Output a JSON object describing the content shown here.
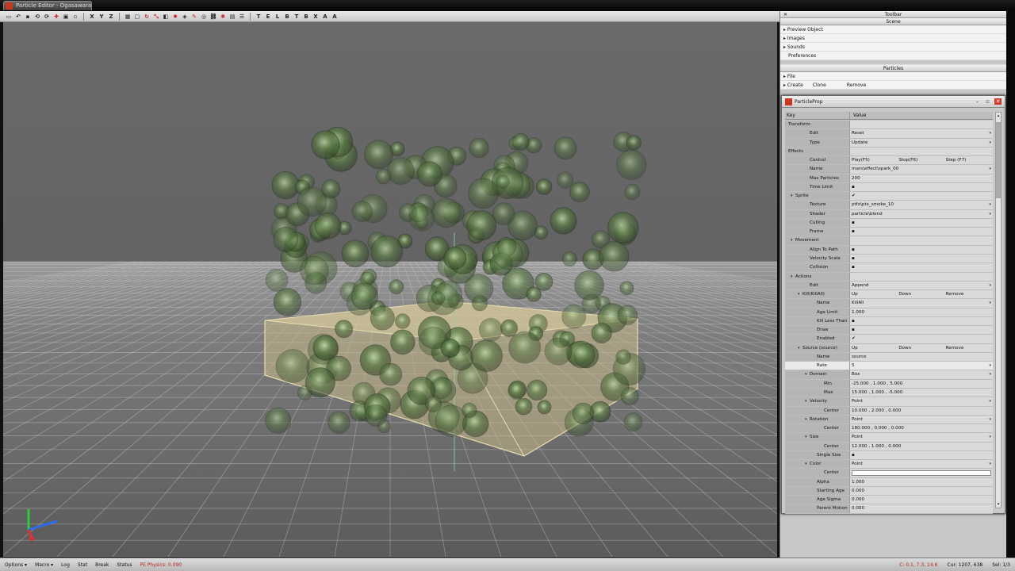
{
  "window": {
    "title": "Particle Editor - Ogasawara"
  },
  "toolbar": {
    "axis_labels": [
      "X",
      "Y",
      "Z"
    ],
    "letters": [
      "T",
      "E",
      "L",
      "B",
      "T",
      "B",
      "X",
      "A",
      "A"
    ]
  },
  "dock": {
    "toolbar_title": "Toolbar",
    "scene_title": "Scene",
    "scene_items": [
      "Preview Object",
      "Images",
      "Sounds",
      "Preferences"
    ],
    "particles_title": "Particles",
    "file_label": "File",
    "actions": [
      "Create",
      "Clone",
      "Remove"
    ]
  },
  "propwin": {
    "title": "ParticleProp",
    "col_key": "Key",
    "col_value": "Value",
    "rows": [
      {
        "k": "Transform",
        "ind": 0,
        "tog": "▾"
      },
      {
        "k": "Edit",
        "ind": 3,
        "v": [
          "Reset"
        ],
        "dd": true
      },
      {
        "k": "Type",
        "ind": 3,
        "v": [
          "Update"
        ],
        "dd": true
      },
      {
        "k": "Effects",
        "ind": 0,
        "tog": "▾"
      },
      {
        "k": "Control",
        "ind": 3,
        "v": [
          "Play(F5)",
          "Stop(F6)",
          "Step (F7)"
        ]
      },
      {
        "k": "Name",
        "ind": 3,
        "v": [
          "mars\\effect\\spark_00"
        ],
        "dd": true
      },
      {
        "k": "Max Particles",
        "ind": 3,
        "v": [
          "200"
        ]
      },
      {
        "k": "Time Limit",
        "ind": 3,
        "v": [
          "▪"
        ]
      },
      {
        "k": "Sprite",
        "ind": 1,
        "tog": "▾",
        "v": [
          "✔"
        ]
      },
      {
        "k": "Texture",
        "ind": 3,
        "v": [
          "ptfx\\ptx_smoke_10"
        ],
        "dd": true
      },
      {
        "k": "Shader",
        "ind": 3,
        "v": [
          "particle\\blend"
        ],
        "dd": true
      },
      {
        "k": "Culling",
        "ind": 3,
        "v": [
          "▪"
        ]
      },
      {
        "k": "Frame",
        "ind": 3,
        "v": [
          "▪"
        ]
      },
      {
        "k": "Movement",
        "ind": 1,
        "tog": "▾"
      },
      {
        "k": "Align To Path",
        "ind": 3,
        "v": [
          "▪"
        ]
      },
      {
        "k": "Velocity Scale",
        "ind": 3,
        "v": [
          "▪"
        ]
      },
      {
        "k": "Collision",
        "ind": 3,
        "v": [
          "▪"
        ]
      },
      {
        "k": "Actions",
        "ind": 1,
        "tog": "▾"
      },
      {
        "k": "Edit",
        "ind": 3,
        "v": [
          "Append"
        ],
        "dd": true
      },
      {
        "k": "Kill(KillAll)",
        "ind": 2,
        "tog": "▾",
        "v": [
          "Up",
          "Down",
          "Remove"
        ]
      },
      {
        "k": "Name",
        "ind": 4,
        "v": [
          "KillAll"
        ],
        "dd": true
      },
      {
        "k": "Age Limit",
        "ind": 4,
        "v": [
          "1.000"
        ]
      },
      {
        "k": "Kill Less Than",
        "ind": 4,
        "v": [
          "▪"
        ]
      },
      {
        "k": "Draw",
        "ind": 4,
        "v": [
          "▪"
        ]
      },
      {
        "k": "Enabled",
        "ind": 4,
        "v": [
          "✔"
        ]
      },
      {
        "k": "Source (source)",
        "ind": 2,
        "tog": "▾",
        "v": [
          "Up",
          "Down",
          "Remove"
        ]
      },
      {
        "k": "Name",
        "ind": 4,
        "v": [
          "source"
        ]
      },
      {
        "k": "Rate",
        "ind": 4,
        "v": [
          "5"
        ],
        "sel": true,
        "dd": true
      },
      {
        "k": "Domain",
        "ind": 3,
        "tog": "▾",
        "v": [
          "Box"
        ],
        "dd": true
      },
      {
        "k": "Min",
        "ind": 5,
        "v": [
          "-25.000 , 1.000 , 5.000"
        ]
      },
      {
        "k": "Max",
        "ind": 5,
        "v": [
          "15.000 , 1.000 , -5.000"
        ]
      },
      {
        "k": "Velocity",
        "ind": 3,
        "tog": "▾",
        "v": [
          "Point"
        ],
        "dd": true
      },
      {
        "k": "Center",
        "ind": 5,
        "v": [
          "10.000 , 2.000 , 0.000"
        ]
      },
      {
        "k": "Rotation",
        "ind": 3,
        "tog": "▾",
        "v": [
          "Point"
        ],
        "dd": true
      },
      {
        "k": "Center",
        "ind": 5,
        "v": [
          "180.000 , 0.000 , 0.000"
        ]
      },
      {
        "k": "Size",
        "ind": 3,
        "tog": "▾",
        "v": [
          "Point"
        ],
        "dd": true
      },
      {
        "k": "Center",
        "ind": 5,
        "v": [
          "12.000 , 1.000 , 0.000"
        ]
      },
      {
        "k": "Single Size",
        "ind": 4,
        "v": [
          "▪"
        ]
      },
      {
        "k": "Color",
        "ind": 3,
        "tog": "▾",
        "v": [
          "Point"
        ],
        "dd": true
      },
      {
        "k": "Center",
        "ind": 5,
        "v": [],
        "white": true
      },
      {
        "k": "Alpha",
        "ind": 4,
        "v": [
          "1.000"
        ]
      },
      {
        "k": "Starting Age",
        "ind": 4,
        "v": [
          "0.000"
        ]
      },
      {
        "k": "Age Sigma",
        "ind": 4,
        "v": [
          "0.000"
        ]
      },
      {
        "k": "Parent Motion",
        "ind": 4,
        "v": [
          "0.000"
        ]
      }
    ]
  },
  "statusbar": {
    "items": [
      "Options ▾",
      "Macro ▾",
      "Log",
      "Stat",
      "Break",
      "Status"
    ],
    "physics": "PE Physics: 0.090",
    "coords": "C: 0.1, 7.3, 14.6",
    "cur": "Cur: 1207, 638",
    "sel": "Sel: 1/3"
  }
}
